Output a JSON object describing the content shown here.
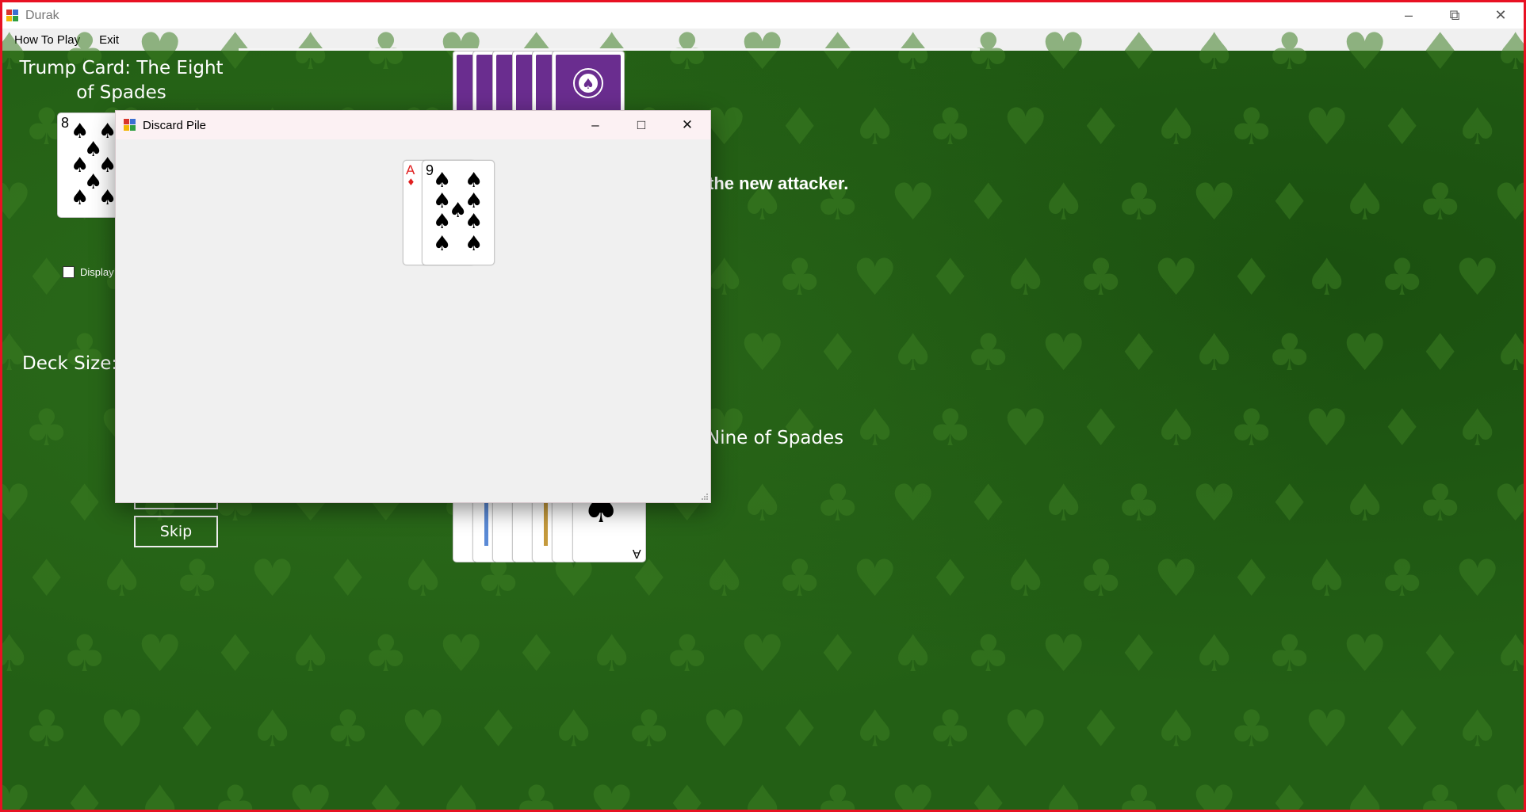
{
  "window": {
    "title": "Durak",
    "minimize_glyph": "–",
    "restore_glyph": "⧉",
    "close_glyph": "✕"
  },
  "menu": {
    "items": [
      "How To Play",
      "Exit"
    ]
  },
  "game": {
    "trump_label": "Trump Card: The Eight of Spades",
    "trump_card": {
      "rank": "8",
      "suit": "♠"
    },
    "checkbox_label": "Display",
    "deck_size_label": "Deck Size:",
    "status_text": "the new attacker.",
    "played_text": "Nine of Spades",
    "skip_label": "Skip"
  },
  "dialog": {
    "title": "Discard Pile",
    "minimize_glyph": "–",
    "maximize_glyph": "□",
    "close_glyph": "✕",
    "cards": [
      {
        "rank": "A",
        "suit": "♦",
        "color": "#e02020"
      },
      {
        "rank": "9",
        "suit": "♠",
        "color": "#000000"
      }
    ]
  },
  "player_hand": {
    "visible_rank": "A",
    "visible_suit": "♠"
  },
  "colors": {
    "felt": "#235f15",
    "card_back": "#6a2d8f",
    "frame": "#e81123",
    "red_suit": "#e02020"
  }
}
